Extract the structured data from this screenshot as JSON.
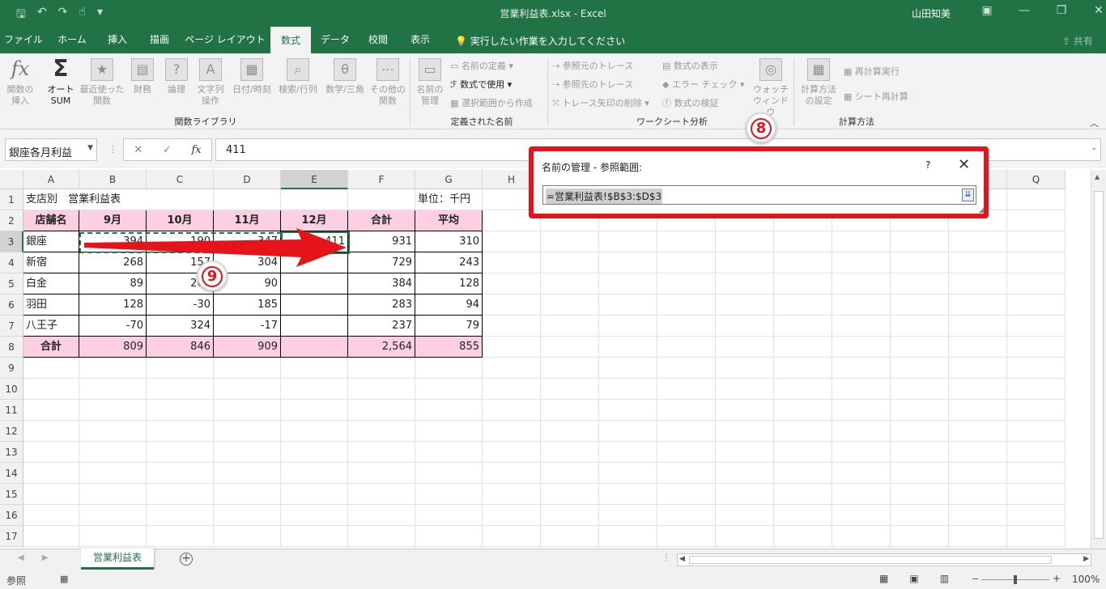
{
  "window": {
    "title": "営業利益表.xlsx  -  Excel",
    "user": "山田知美",
    "share": "共有",
    "tell_me": "実行したい作業を入力してください"
  },
  "tabs": [
    "ファイル",
    "ホーム",
    "挿入",
    "描画",
    "ページ レイアウト",
    "数式",
    "データ",
    "校閲",
    "表示"
  ],
  "active_tab": "数式",
  "ribbon": {
    "function_library": {
      "label": "関数ライブラリ",
      "buttons": [
        {
          "label": "関数の\n挿入",
          "icon": "fx-icon"
        },
        {
          "label": "オート\nSUM",
          "icon": "sigma-icon"
        },
        {
          "label": "最近使った\n関数",
          "icon": "star-book-icon"
        },
        {
          "label": "財務",
          "icon": "finance-book-icon"
        },
        {
          "label": "論理",
          "icon": "question-book-icon"
        },
        {
          "label": "文字列\n操作",
          "icon": "text-book-icon"
        },
        {
          "label": "日付/時刻",
          "icon": "calendar-book-icon"
        },
        {
          "label": "検索/行列",
          "icon": "search-book-icon"
        },
        {
          "label": "数学/三角",
          "icon": "theta-book-icon"
        },
        {
          "label": "その他の\n関数",
          "icon": "more-book-icon"
        }
      ]
    },
    "defined_names": {
      "label": "定義された名前",
      "name_manager": "名前の\n管理",
      "define_name": "名前の定義",
      "use_in_formula": "数式で使用",
      "create_from_selection": "選択範囲から作成"
    },
    "formula_auditing": {
      "label": "ワークシート分析",
      "trace_precedents": "参照元のトレース",
      "trace_dependents": "参照先のトレース",
      "remove_arrows": "トレース矢印の削除",
      "show_formulas": "数式の表示",
      "error_checking": "エラー チェック",
      "evaluate_formula": "数式の検証",
      "watch_window": "ウォッチ\nウィンドウ"
    },
    "calculation": {
      "label": "計算方法",
      "options": "計算方法\nの設定",
      "calc_now": "再計算実行",
      "calc_sheet": "シート再計算"
    }
  },
  "formula_bar": {
    "name_box": "銀座各月利益",
    "value": "411"
  },
  "columns": [
    "A",
    "B",
    "C",
    "D",
    "E",
    "F",
    "G",
    "H",
    "I",
    "J",
    "K",
    "L",
    "M",
    "N",
    "O",
    "P",
    "Q"
  ],
  "selected_column": "E",
  "rows": [
    "1",
    "2",
    "3",
    "4",
    "5",
    "6",
    "7",
    "8",
    "9",
    "10",
    "11",
    "12",
    "13",
    "14",
    "15",
    "16",
    "17"
  ],
  "selected_row": "3",
  "sheet": {
    "title": "支店別　営業利益表",
    "unit": "単位：千円",
    "headers": [
      "店舗名",
      "9月",
      "10月",
      "11月",
      "12月",
      "合計",
      "平均"
    ],
    "data": [
      [
        "銀座",
        "394",
        "190",
        "347",
        "411",
        "931",
        "310"
      ],
      [
        "新宿",
        "268",
        "157",
        "304",
        "",
        "729",
        "243"
      ],
      [
        "白金",
        "89",
        "205",
        "90",
        "",
        "384",
        "128"
      ],
      [
        "羽田",
        "128",
        "-30",
        "185",
        "",
        "283",
        "94"
      ],
      [
        "八王子",
        "-70",
        "324",
        "-17",
        "",
        "237",
        "79"
      ]
    ],
    "total": [
      "合計",
      "809",
      "846",
      "909",
      "",
      "2,564",
      "855"
    ]
  },
  "dialog": {
    "title": "名前の管理 - 参照範囲:",
    "help": "?",
    "close": "✕",
    "value": "=営業利益表!$B$3:$D$3"
  },
  "callouts": {
    "eight": "8",
    "nine": "9"
  },
  "sheet_tab": "営業利益表",
  "status": {
    "mode": "参照",
    "zoom": "100%"
  },
  "colors": {
    "excel_green": "#217346",
    "header_pink": "#fccfe2",
    "callout_red": "#e5131a"
  }
}
